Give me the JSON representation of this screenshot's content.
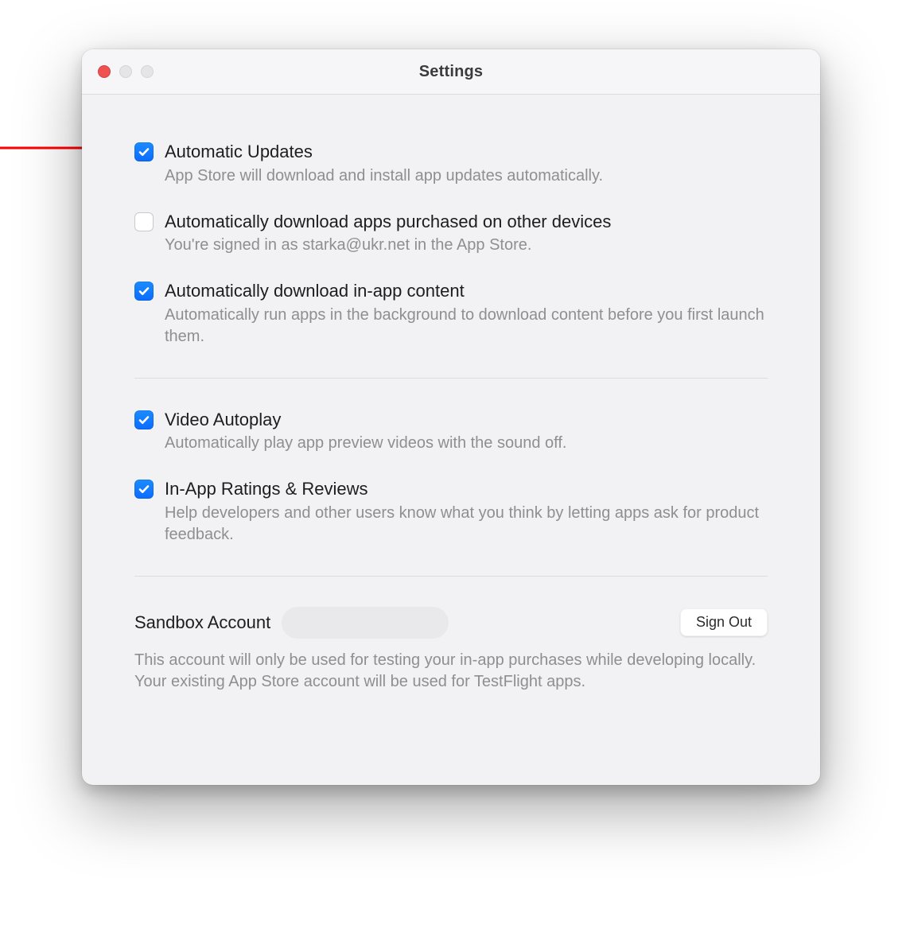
{
  "window": {
    "title": "Settings"
  },
  "settings": [
    {
      "label": "Automatic Updates",
      "description": "App Store will download and install app updates automatically.",
      "checked": true
    },
    {
      "label": "Automatically download apps purchased on other devices",
      "description": "You're signed in as starka@ukr.net in the App Store.",
      "checked": false
    },
    {
      "label": "Automatically download in-app content",
      "description": "Automatically run apps in the background to download content before you first launch them.",
      "checked": true
    }
  ],
  "settings2": [
    {
      "label": "Video Autoplay",
      "description": "Automatically play app preview videos with the sound off.",
      "checked": true
    },
    {
      "label": "In-App Ratings & Reviews",
      "description": "Help developers and other users know what you think by letting apps ask for product feedback.",
      "checked": true
    }
  ],
  "sandbox": {
    "title": "Sandbox Account",
    "signout": "Sign Out",
    "description": "This account will only be used for testing your in-app purchases while developing locally. Your existing App Store account will be used for TestFlight apps."
  },
  "colors": {
    "accent": "#0a6cff"
  }
}
